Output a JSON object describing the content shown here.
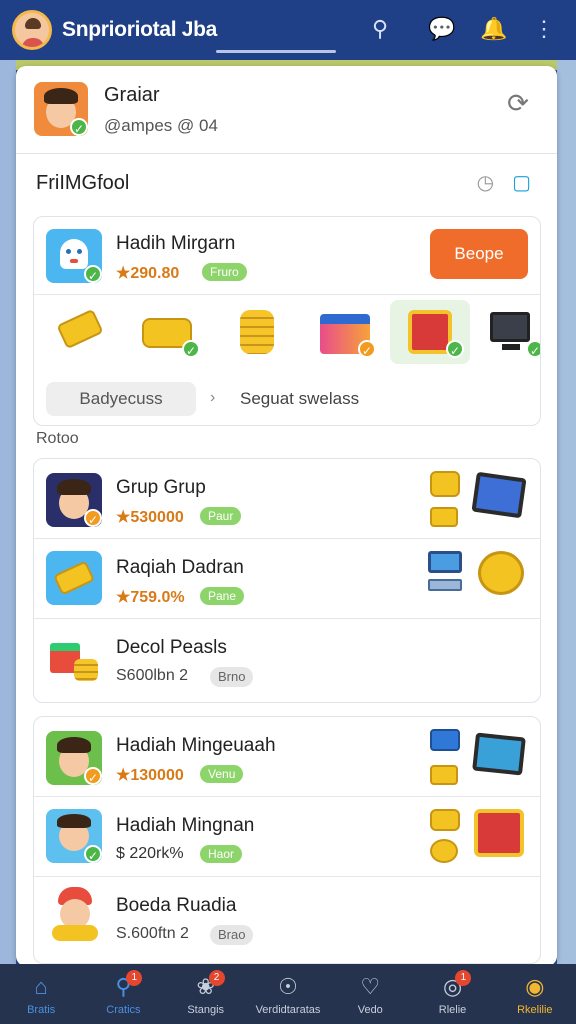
{
  "app": {
    "title": "Snprioriotal Jba"
  },
  "profile": {
    "name": "Graiar",
    "sub": "@ampes  @ 04"
  },
  "section": {
    "title": "FriIMGfool"
  },
  "featured": {
    "title": "Hadih Mirgarn",
    "price": "★290.80",
    "pill": "Fruro",
    "button": "Beope",
    "chip": "Badyecuss",
    "chip_right": "Seguat swelass"
  },
  "list_label": "Rotoo",
  "group1": [
    {
      "title": "Grup Grup",
      "price": "★530000",
      "pill": "Paur"
    },
    {
      "title": "Raqiah Dadran",
      "price": "★759.0%",
      "pill": "Pane"
    },
    {
      "title": "Decol Peasls",
      "sub": "S600lbn  2",
      "tag": "Brno"
    }
  ],
  "group2": [
    {
      "title": "Hadiah Mingeuaah",
      "price": "★130000",
      "pill": "Venu"
    },
    {
      "title": "Hadiah Mingnan",
      "price": "$ 220rk%",
      "pill": "Haor"
    },
    {
      "title": "Boeda Ruadia",
      "sub": "S.600ftn  2",
      "tag": "Brao"
    }
  ],
  "nav": [
    {
      "label": "Bratis",
      "icon": "home-icon",
      "badge": ""
    },
    {
      "label": "Cratics",
      "icon": "search-icon",
      "badge": "1"
    },
    {
      "label": "Stangis",
      "icon": "group-icon",
      "badge": "2"
    },
    {
      "label": "Verdidtaratas",
      "icon": "compass-icon",
      "badge": ""
    },
    {
      "label": "Vedo",
      "icon": "heart-icon",
      "badge": ""
    },
    {
      "label": "Rlelie",
      "icon": "target-icon",
      "badge": "1"
    },
    {
      "label": "Rkelilie",
      "icon": "profile-icon",
      "badge": ""
    }
  ]
}
